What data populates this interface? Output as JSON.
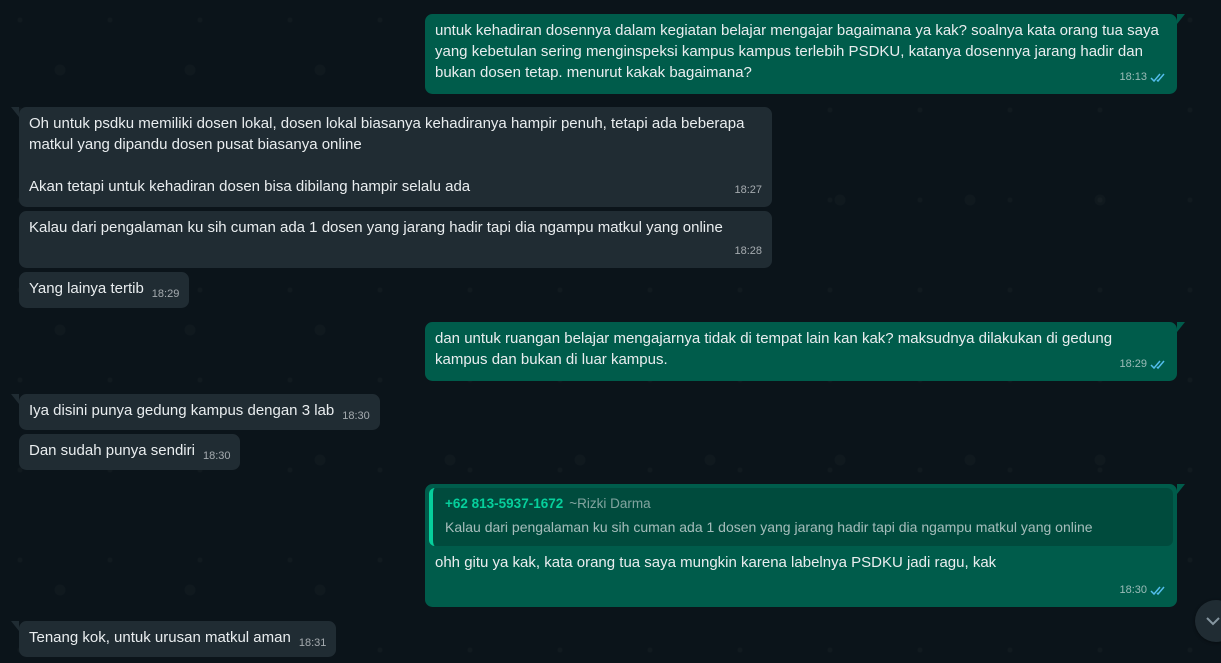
{
  "messages": [
    {
      "dir": "out",
      "time": "18:13",
      "text": "untuk kehadiran dosennya dalam kegiatan belajar mengajar bagaimana ya kak? soalnya kata orang tua saya yang kebetulan sering menginspeksi kampus kampus terlebih PSDKU, katanya dosennya jarang hadir dan bukan dosen tetap. menurut kakak bagaimana?"
    },
    {
      "dir": "in",
      "time": "18:27",
      "text": "Oh untuk psdku memiliki dosen lokal, dosen lokal biasanya kehadiranya hampir penuh, tetapi ada beberapa matkul yang dipandu dosen pusat biasanya online\n\nAkan tetapi untuk kehadiran dosen bisa dibilang hampir selalu ada"
    },
    {
      "dir": "in",
      "time": "18:28",
      "text": "Kalau dari pengalaman ku sih cuman ada 1 dosen yang jarang hadir tapi dia ngampu matkul yang online"
    },
    {
      "dir": "in",
      "time": "18:29",
      "text": "Yang lainya tertib"
    },
    {
      "dir": "out",
      "time": "18:29",
      "text": "dan untuk ruangan belajar mengajarnya tidak di tempat lain kan kak? maksudnya dilakukan di gedung kampus dan bukan di luar kampus."
    },
    {
      "dir": "in",
      "time": "18:30",
      "text": "Iya disini punya gedung kampus dengan 3 lab"
    },
    {
      "dir": "in",
      "time": "18:30",
      "text": "Dan sudah punya sendiri"
    },
    {
      "dir": "out",
      "time": "18:30",
      "text": "ohh gitu ya kak, kata orang tua saya mungkin karena labelnya PSDKU jadi ragu, kak",
      "quote": {
        "phone": "+62 813-5937-1672",
        "name": "~Rizki Darma",
        "text": "Kalau dari pengalaman ku sih cuman ada 1 dosen yang jarang hadir tapi dia ngampu matkul yang online"
      }
    },
    {
      "dir": "in",
      "time": "18:31",
      "text": "Tenang kok, untuk urusan matkul aman"
    }
  ],
  "colors": {
    "incoming": "#202c33",
    "outgoing": "#005c4b",
    "background": "#0b141a",
    "read_ticks": "#53bdeb",
    "quote_accent": "#06cf9c"
  },
  "icons": {
    "read_receipt": "double-check-icon",
    "scroll": "chevron-down-icon"
  }
}
